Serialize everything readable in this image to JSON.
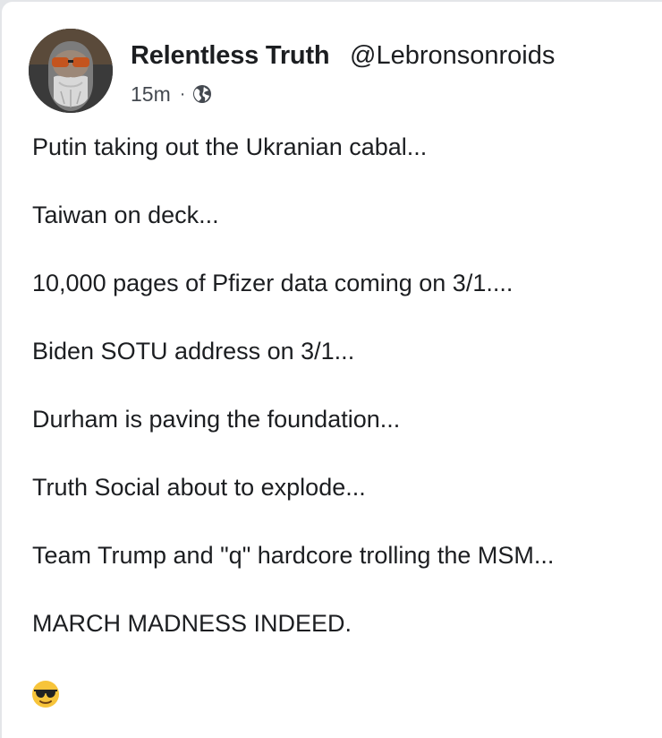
{
  "post": {
    "author_name": "Relentless Truth",
    "author_handle": "@Lebronsonroids",
    "timestamp": "15m",
    "separator": "·",
    "privacy_icon": "globe-icon",
    "lines": [
      "Putin taking out the Ukranian cabal...",
      "Taiwan on deck...",
      "10,000 pages of Pfizer data coming on 3/1....",
      "Biden SOTU address on 3/1...",
      "Durham is paving the foundation...",
      "Truth Social about to explode...",
      "Team Trump and \"q\" hardcore trolling the MSM...",
      "MARCH MADNESS INDEED."
    ],
    "emoji_icon": "sunglasses-emoji-icon"
  },
  "colors": {
    "text_primary": "#1c1e21",
    "text_secondary": "#444950",
    "card_background": "#ffffff",
    "emoji_yellow": "#f7c43a"
  }
}
